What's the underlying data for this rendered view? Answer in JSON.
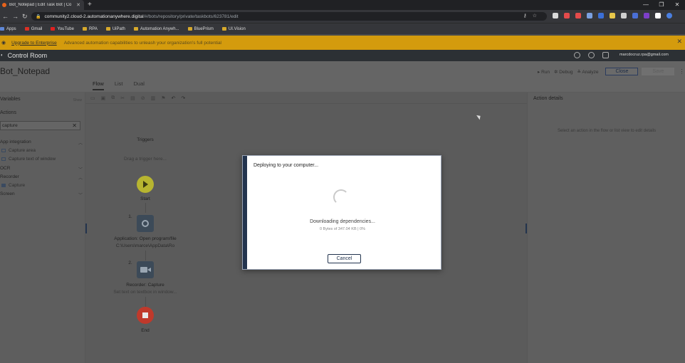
{
  "browser": {
    "tab_title": "Bot_Notepad | Edit Task Bot | Co",
    "new_tab": "+",
    "url_host": "community2.cloud-2.automationanywhere.digital",
    "url_path": "/#/bots/repository/private/taskbots/623781/edit",
    "bookmarks": [
      {
        "label": "Apps",
        "color": "#5f87d6"
      },
      {
        "label": "Gmail",
        "color": "#d93025"
      },
      {
        "label": "YouTube",
        "color": "#e02020"
      },
      {
        "label": "RPA",
        "color": "#d6a92b"
      },
      {
        "label": "UiPath",
        "color": "#d6a92b"
      },
      {
        "label": "Automation Anywh...",
        "color": "#d6a92b"
      },
      {
        "label": "BluePrism",
        "color": "#d6a92b"
      },
      {
        "label": "UI.Vision",
        "color": "#d6a92b"
      }
    ],
    "extension_colors": [
      "#d9d9d9",
      "#e34b4b",
      "#e34b4b",
      "#7aa0e0",
      "#3b6fd6",
      "#e8c74a",
      "#cfcfcf",
      "#4a6fd6",
      "#7d3fc8",
      "#ffffff",
      "#4a7fe0"
    ]
  },
  "banner": {
    "link": "Upgrade to Enterprise",
    "text": "Advanced automation capabilities to unleash your organization's full potential",
    "color": "#d49b0d"
  },
  "app": {
    "title": "Control Room",
    "user": "marcdocruz.rpa@gmail.com"
  },
  "bot": {
    "name": "Bot_Notepad",
    "tabs": [
      "Flow",
      "List",
      "Dual"
    ],
    "actions": [
      "Run",
      "Debug",
      "Analyze"
    ],
    "close_label": "Close",
    "save_label": "Save"
  },
  "left_panel": {
    "variables_label": "Variables",
    "show_label": "Show",
    "actions_label": "Actions",
    "search_value": "capture",
    "tree": [
      {
        "label": "App integration",
        "type": "group",
        "expanded": true
      },
      {
        "label": "Capture area",
        "type": "leaf"
      },
      {
        "label": "Capture text of window",
        "type": "leaf"
      },
      {
        "label": "OCR",
        "type": "group",
        "expanded": false
      },
      {
        "label": "Recorder",
        "type": "group",
        "expanded": true
      },
      {
        "label": "Capture",
        "type": "leaf"
      },
      {
        "label": "Screen",
        "type": "group",
        "expanded": false
      }
    ]
  },
  "flow": {
    "triggers_label": "Triggers",
    "trigger_hint": "Drag a trigger here...",
    "start_label": "Start",
    "steps": [
      {
        "number": "1.",
        "title": "Application: Open program/file",
        "subtitle": "C:\\Users\\marce\\AppData\\Ro"
      },
      {
        "number": "2.",
        "title": "Recorder: Capture",
        "subtitle": "Set text on textbox in window..."
      }
    ],
    "end_label": "End",
    "colors": {
      "start": "#b7b530",
      "end": "#c0392b",
      "node": "#3c4a58"
    }
  },
  "right_panel": {
    "title": "Action details",
    "hint": "Select an action in the flow or list view to edit details"
  },
  "modal": {
    "title": "Deploying to your computer...",
    "status": "Downloading dependencies...",
    "progress": "0 Bytes of 347.04 KB  |  0%",
    "progress_percent": 0,
    "cancel_label": "Cancel",
    "accent": "#23344e"
  }
}
